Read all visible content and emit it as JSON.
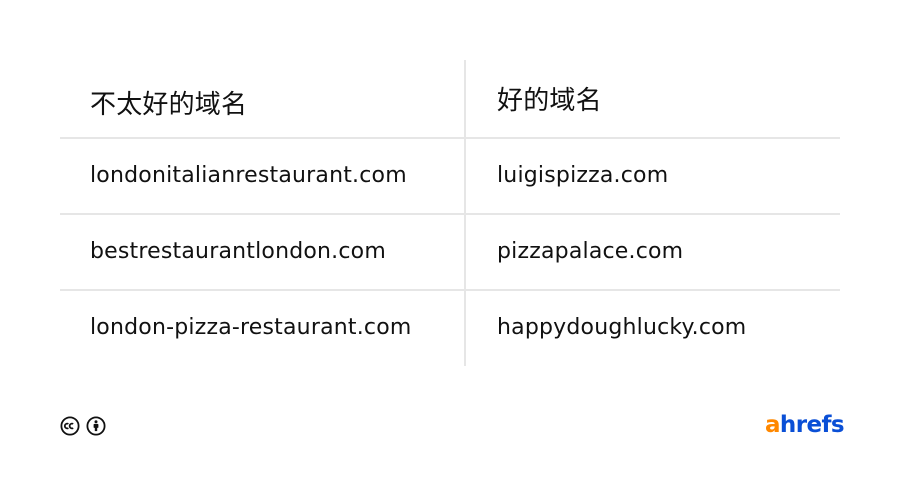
{
  "table": {
    "headers": {
      "bad": "不太好的域名",
      "good": "好的域名"
    },
    "rows": [
      {
        "bad": "londonitalianrestaurant.com",
        "good": "luigispizza.com"
      },
      {
        "bad": "bestrestaurantlondon.com",
        "good": "pizzapalace.com"
      },
      {
        "bad": "london-pizza-restaurant.com",
        "good": "happydoughlucky.com"
      }
    ]
  },
  "footer": {
    "license_icons": [
      "cc-icon",
      "attribution-icon"
    ]
  },
  "logo": {
    "first_letter": "a",
    "rest": "hrefs",
    "colors": {
      "first_letter": "#ff8800",
      "rest": "#0a4fd6"
    }
  }
}
